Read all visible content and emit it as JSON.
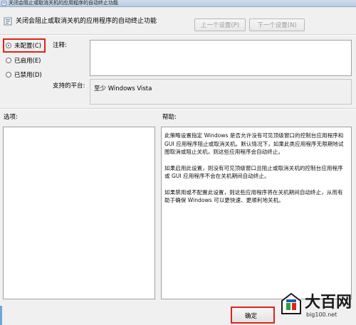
{
  "window": {
    "title": "关闭会阻止或取消关机的应用程序的自动终止功能"
  },
  "header": {
    "title": "关闭会阻止或取消关机的应用程序的自动终止功能",
    "prev_label": "上一个设置(P)",
    "next_label": "下一个设置(N)"
  },
  "state": {
    "options": [
      {
        "label": "未配置(C)",
        "checked": true
      },
      {
        "label": "已启用(E)",
        "checked": false
      },
      {
        "label": "已禁用(D)",
        "checked": false
      }
    ]
  },
  "comment": {
    "label": "注释:",
    "value": ""
  },
  "platform": {
    "label": "支持的平台:",
    "value": "至少 Windows Vista"
  },
  "options_section": {
    "label": "选项:"
  },
  "help": {
    "label": "帮助:",
    "paragraphs": [
      "此策略设置指定 Windows 是否允许没有可见顶级窗口的控制台应用程序和 GUI 应用程序阻止或取消关机。默认情况下，如果此类应用程序无限期地试图取消或阻止关机，则这些应用程序会自动终止。",
      "如果启用此设置，则没有可见顶级窗口且阻止或取消关机的控制台应用程序或 GUI 应用程序不会在关机期间自动终止。",
      "如果禁用或不配置此设置，则这些应用程序将在关机期间自动终止，从而有助于确保 Windows 可以更快速、更顺利地关机。"
    ]
  },
  "footer": {
    "ok_label": "确定"
  },
  "watermark": {
    "name": "大百网",
    "url": "big100.net"
  },
  "colors": {
    "highlight": "#e2231a",
    "titlebar": "#c4d5e8",
    "background": "#f0f0f0"
  }
}
